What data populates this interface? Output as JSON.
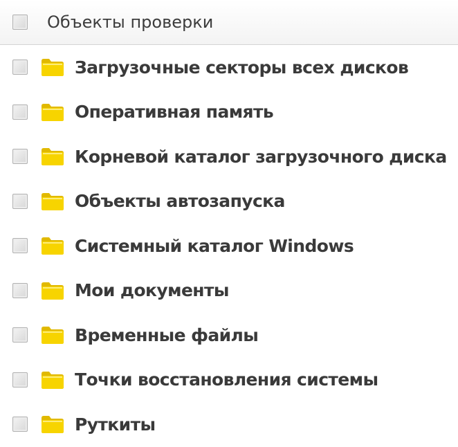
{
  "header": {
    "label": "Объекты проверки"
  },
  "items": [
    {
      "label": "Загрузочные секторы всех дисков"
    },
    {
      "label": "Оперативная память"
    },
    {
      "label": "Корневой каталог загрузочного диска"
    },
    {
      "label": "Объекты автозапуска"
    },
    {
      "label": "Системный каталог Windows"
    },
    {
      "label": "Мои документы"
    },
    {
      "label": "Временные файлы"
    },
    {
      "label": "Точки восстановления системы"
    },
    {
      "label": "Руткиты"
    }
  ],
  "icons": {
    "checkbox": "checkbox-unchecked",
    "folder": "folder-icon"
  },
  "colors": {
    "folder_fill": "#f7d400",
    "folder_tab": "#e1b900",
    "text": "#3a3a3a",
    "checkbox_border": "#b1b1b1"
  }
}
